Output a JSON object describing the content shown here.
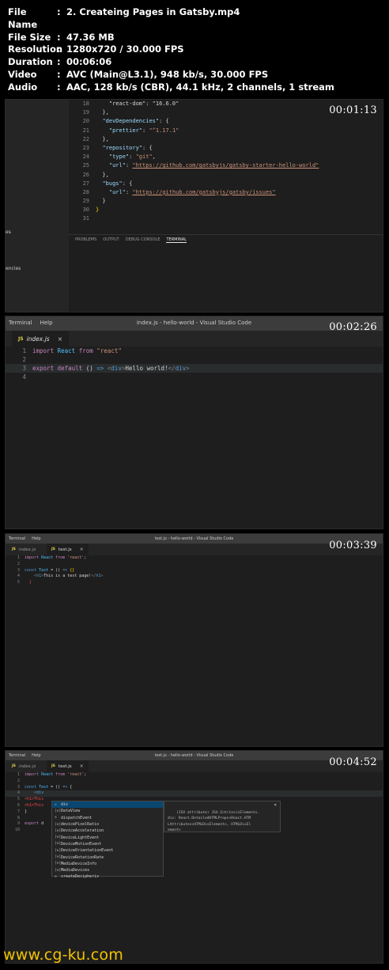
{
  "info": [
    {
      "key": "File Name",
      "value": "2. Createing Pages in Gatsby.mp4"
    },
    {
      "key": "File Size",
      "value": "47.36 MB"
    },
    {
      "key": "Resolution",
      "value": "1280x720 / 30.000 FPS"
    },
    {
      "key": "Duration",
      "value": "00:06:06"
    },
    {
      "key": "Video",
      "value": "AVC (Main@L3.1), 948 kb/s, 30.000 FPS"
    },
    {
      "key": "Audio",
      "value": "AAC, 128 kb/s (CBR), 44.1 kHz, 2 channels, 1 stream"
    }
  ],
  "info_sep": ":",
  "frames": [
    {
      "timestamp": "00:01:13",
      "sidebar_items": [
        "es",
        "encies"
      ],
      "panel_tabs": [
        "PROBLEMS",
        "OUTPUT",
        "DEBUG CONSOLE",
        "TERMINAL"
      ],
      "code_lines": [
        {
          "n": "18",
          "parts": [
            [
              "p",
              "    \"react-dom\": \"16.6.0\""
            ]
          ]
        },
        {
          "n": "19",
          "parts": [
            [
              "p",
              "  },"
            ]
          ]
        },
        {
          "n": "20",
          "parts": [
            [
              "p",
              "  "
            ],
            [
              "key",
              "\"devDependencies\""
            ],
            [
              "p",
              ": {"
            ]
          ]
        },
        {
          "n": "21",
          "parts": [
            [
              "p",
              "    "
            ],
            [
              "key",
              "\"prettier\""
            ],
            [
              "p",
              ": "
            ],
            [
              "str",
              "\"^1.17.1\""
            ]
          ]
        },
        {
          "n": "22",
          "parts": [
            [
              "p",
              "  },"
            ]
          ]
        },
        {
          "n": "23",
          "parts": [
            [
              "p",
              "  "
            ],
            [
              "key",
              "\"repository\""
            ],
            [
              "p",
              ": {"
            ]
          ]
        },
        {
          "n": "24",
          "parts": [
            [
              "p",
              "    "
            ],
            [
              "key",
              "\"type\""
            ],
            [
              "p",
              ": "
            ],
            [
              "str",
              "\"git\""
            ],
            [
              "p",
              ","
            ]
          ]
        },
        {
          "n": "25",
          "parts": [
            [
              "p",
              "    "
            ],
            [
              "key",
              "\"url\""
            ],
            [
              "p",
              ": "
            ],
            [
              "url",
              "\"https://github.com/gatsbyjs/gatsby-starter-hello-world\""
            ]
          ]
        },
        {
          "n": "26",
          "parts": [
            [
              "p",
              "  },"
            ]
          ]
        },
        {
          "n": "27",
          "parts": [
            [
              "p",
              "  "
            ],
            [
              "key",
              "\"bugs\""
            ],
            [
              "p",
              ": {"
            ]
          ]
        },
        {
          "n": "28",
          "parts": [
            [
              "p",
              "    "
            ],
            [
              "key",
              "\"url\""
            ],
            [
              "p",
              ": "
            ],
            [
              "url",
              "\"https://github.com/gatsbyjs/gatsby/issues\""
            ]
          ]
        },
        {
          "n": "29",
          "parts": [
            [
              "p",
              "  }"
            ]
          ]
        },
        {
          "n": "30",
          "parts": [
            [
              "brace",
              "}"
            ]
          ]
        },
        {
          "n": "31",
          "parts": []
        }
      ]
    },
    {
      "timestamp": "00:02:26",
      "menu": [
        "Terminal",
        "Help"
      ],
      "window_title": "index.js - hello-world - Visual Studio Code",
      "tabs": [
        {
          "badge": "JS",
          "name": "index.js",
          "close": "×"
        }
      ],
      "code_lines": [
        {
          "n": "1",
          "parts": [
            [
              "kw2",
              "import"
            ],
            [
              "p",
              " "
            ],
            [
              "var",
              "React"
            ],
            [
              "p",
              " "
            ],
            [
              "kw2",
              "from"
            ],
            [
              "p",
              " "
            ],
            [
              "str",
              "\"react\""
            ]
          ]
        },
        {
          "n": "2",
          "parts": []
        },
        {
          "n": "3",
          "parts": [
            [
              "kw2",
              "export"
            ],
            [
              "p",
              " "
            ],
            [
              "kw2",
              "default"
            ],
            [
              "p",
              " () "
            ],
            [
              "kw",
              "=>"
            ],
            [
              "p",
              " "
            ],
            [
              "tag",
              "<"
            ],
            [
              "tname",
              "div"
            ],
            [
              "tag",
              ">"
            ],
            [
              "txt",
              "Hello world!"
            ],
            [
              "tag",
              "</"
            ],
            [
              "tname",
              "div"
            ],
            [
              "tag",
              ">"
            ]
          ]
        },
        {
          "n": "4",
          "parts": []
        }
      ]
    },
    {
      "timestamp": "00:03:39",
      "menu": [
        "Terminal",
        "Help"
      ],
      "window_title": "test.js - hello-world - Visual Studio Code",
      "tabs": [
        {
          "badge": "JS",
          "name": "index.js",
          "close": ""
        },
        {
          "badge": "JS",
          "name": "test.js",
          "close": "×"
        }
      ],
      "code_lines": [
        {
          "n": "1",
          "parts": [
            [
              "kw2",
              "import"
            ],
            [
              "p",
              " "
            ],
            [
              "var",
              "React"
            ],
            [
              "p",
              " "
            ],
            [
              "kw2",
              "from"
            ],
            [
              "p",
              " "
            ],
            [
              "str",
              "'react'"
            ],
            [
              "p",
              ";"
            ]
          ]
        },
        {
          "n": "2",
          "parts": []
        },
        {
          "n": "3",
          "parts": [
            [
              "kw",
              "const"
            ],
            [
              "p",
              " "
            ],
            [
              "var",
              "Test"
            ],
            [
              "p",
              " = () "
            ],
            [
              "kw",
              "=>"
            ],
            [
              "p",
              " "
            ],
            [
              "brace",
              "{}"
            ]
          ]
        },
        {
          "n": "4",
          "parts": [
            [
              "p",
              "    "
            ],
            [
              "tag",
              "<"
            ],
            [
              "tname",
              "h1"
            ],
            [
              "tag",
              ">"
            ],
            [
              "txt",
              "This is a test page!"
            ],
            [
              "tag",
              "</"
            ],
            [
              "tname",
              "h1"
            ],
            [
              "tag",
              ">"
            ]
          ]
        },
        {
          "n": "5",
          "parts": [
            [
              "err",
              "  }"
            ]
          ]
        }
      ]
    },
    {
      "timestamp": "00:04:52",
      "menu": [
        "Terminal",
        "Help"
      ],
      "window_title": "test.js - hello-world - Visual Studio Code",
      "tabs": [
        {
          "badge": "JS",
          "name": "index.js",
          "close": ""
        },
        {
          "badge": "JS",
          "name": "test.js",
          "close": "×"
        }
      ],
      "code_lines": [
        {
          "n": "1",
          "parts": [
            [
              "kw2",
              "import"
            ],
            [
              "p",
              " "
            ],
            [
              "var",
              "React"
            ],
            [
              "p",
              " "
            ],
            [
              "kw2",
              "from"
            ],
            [
              "p",
              " "
            ],
            [
              "str",
              "'react'"
            ],
            [
              "p",
              ";"
            ]
          ]
        },
        {
          "n": "2",
          "parts": []
        },
        {
          "n": "3",
          "parts": [
            [
              "kw",
              "const"
            ],
            [
              "p",
              " "
            ],
            [
              "var",
              "Test"
            ],
            [
              "p",
              " = () "
            ],
            [
              "kw",
              "=>"
            ],
            [
              "p",
              " {"
            ]
          ]
        },
        {
          "n": "4",
          "parts": [
            [
              "p",
              "    "
            ],
            [
              "tag",
              "<"
            ],
            [
              "tname",
              "div"
            ]
          ]
        },
        {
          "n": "5",
          "parts": [
            [
              "err",
              "<h1>This"
            ]
          ]
        },
        {
          "n": "6",
          "parts": [
            [
              "err",
              "<h1>This"
            ]
          ]
        },
        {
          "n": "7",
          "parts": [
            [
              "p",
              "}"
            ]
          ]
        },
        {
          "n": "8",
          "parts": []
        },
        {
          "n": "9",
          "parts": [
            [
              "kw2",
              "export"
            ],
            [
              "p",
              " d"
            ]
          ]
        },
        {
          "n": "10",
          "parts": []
        }
      ],
      "autocomplete": [
        {
          "icon": "◇",
          "label": "div"
        },
        {
          "icon": "[e]",
          "label": "DataView"
        },
        {
          "icon": "⊙",
          "label": "dispatchEvent"
        },
        {
          "icon": "[e]",
          "label": "devicePixelRatio"
        },
        {
          "icon": "[e]",
          "label": "DeviceAcceleration"
        },
        {
          "icon": "[e]",
          "label": "DeviceLightEvent"
        },
        {
          "icon": "[e]",
          "label": "DeviceMotionEvent"
        },
        {
          "icon": "[e]",
          "label": "DeviceOrientationEvent"
        },
        {
          "icon": "[e]",
          "label": "DeviceRotationRate"
        },
        {
          "icon": "[e]",
          "label": "MediaDeviceInfo"
        },
        {
          "icon": "[e]",
          "label": "MediaDevices"
        },
        {
          "icon": "⊙",
          "label": "createDecipheriv"
        }
      ],
      "doc": "(JSX attribute) JSX.IntrinsicElements.\ndiv: React.DetailedHTMLProps<React.HTM\nLAttributes<HTMLDivElement>, HTMLDivEl\nement>",
      "doc_close": "×"
    }
  ],
  "watermark": "www.cg-ku.com",
  "colors": {
    "accent_watermark": "#f2c200",
    "editor_bg": "#1e1e1e",
    "titlebar_bg": "#3c3c3c"
  }
}
